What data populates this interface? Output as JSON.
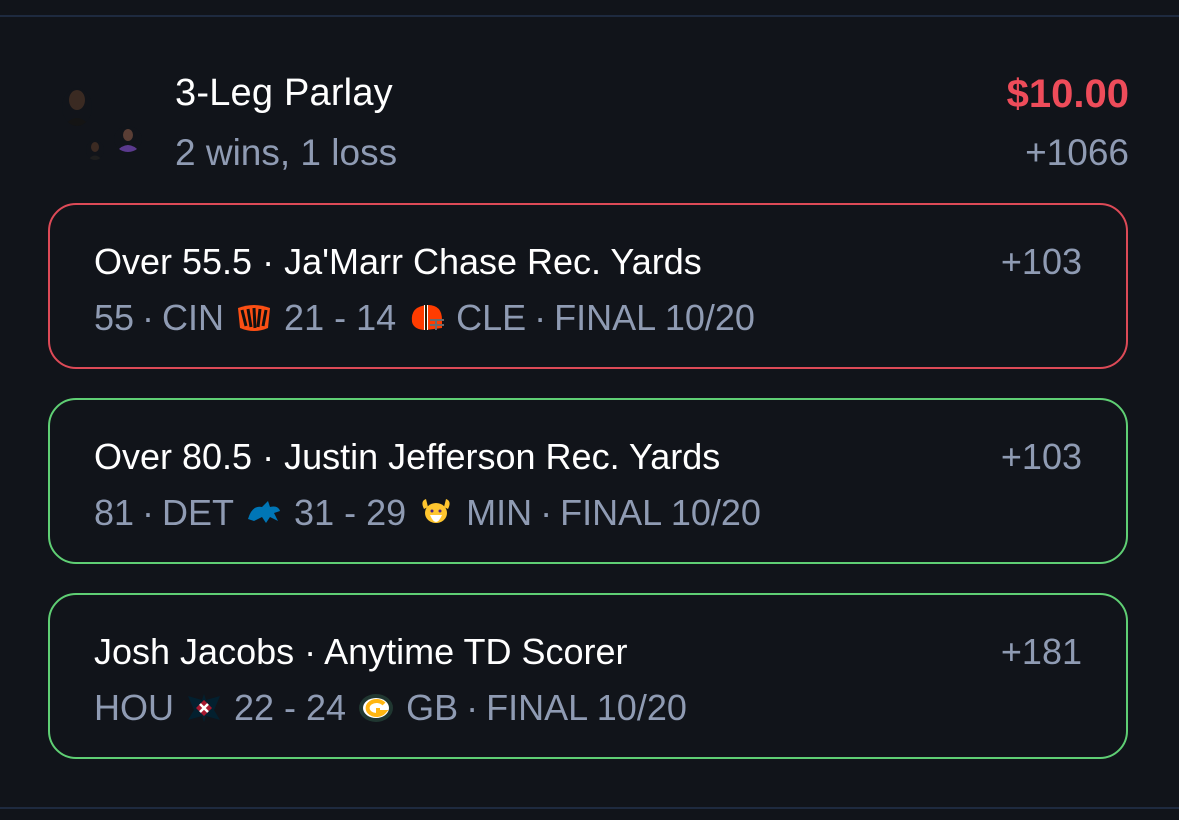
{
  "parlay": {
    "title": "3-Leg Parlay",
    "record": "2 wins, 1 loss",
    "stake": "$10.00",
    "odds": "+1066",
    "stake_color": "#ee4c5a"
  },
  "legs": [
    {
      "status": "loss",
      "title": "Over 55.5 · Ja'Marr Chase Rec. Yards",
      "odds": "+103",
      "stat": "55",
      "home_team": "CIN",
      "home_logo_icon": "bengals-logo-icon",
      "score": "21 - 14",
      "away_logo_icon": "browns-helmet-icon",
      "away_team": "CLE",
      "result": "FINAL 10/20"
    },
    {
      "status": "win",
      "title": "Over 80.5 · Justin Jefferson Rec. Yards",
      "odds": "+103",
      "stat": "81",
      "home_team": "DET",
      "home_logo_icon": "lions-logo-icon",
      "score": "31 - 29",
      "away_logo_icon": "vikings-logo-icon",
      "away_team": "MIN",
      "result": "FINAL 10/20"
    },
    {
      "status": "win",
      "title": "Josh Jacobs · Anytime TD Scorer",
      "odds": "+181",
      "home_team": "HOU",
      "home_logo_icon": "texans-logo-icon",
      "score": "22 - 24",
      "away_logo_icon": "packers-logo-icon",
      "away_team": "GB",
      "result": "FINAL 10/20"
    }
  ],
  "colors": {
    "background": "#11141a",
    "loss_border": "#dd4a57",
    "win_border": "#5fcf74",
    "secondary_text": "#8f9bb3"
  }
}
